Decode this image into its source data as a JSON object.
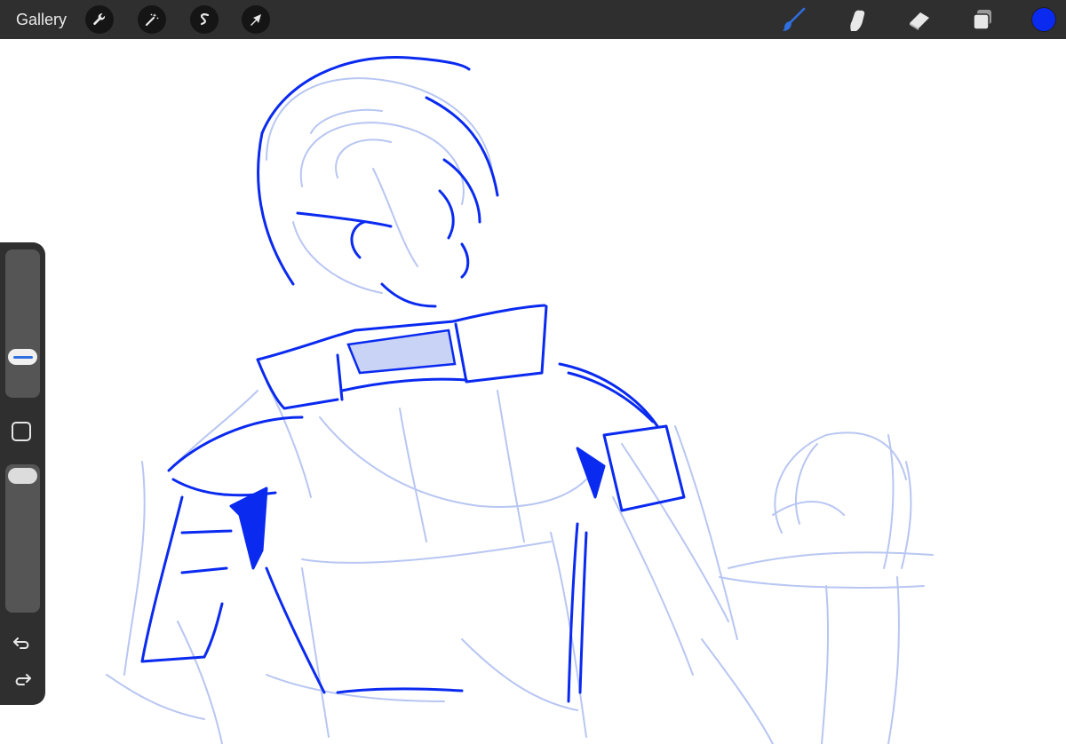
{
  "topbar": {
    "gallery_label": "Gallery",
    "left_tools": [
      {
        "name": "actions",
        "icon": "wrench-icon"
      },
      {
        "name": "adjustments",
        "icon": "magic-wand-icon"
      },
      {
        "name": "selection",
        "icon": "selection-s-icon"
      },
      {
        "name": "transform",
        "icon": "arrow-cursor-icon"
      }
    ],
    "right_tools": [
      {
        "name": "brush",
        "icon": "brush-icon",
        "active": true
      },
      {
        "name": "smudge",
        "icon": "smudge-icon"
      },
      {
        "name": "eraser",
        "icon": "eraser-icon"
      },
      {
        "name": "layers",
        "icon": "layers-icon"
      }
    ],
    "current_color": "#0a2af0",
    "active_tool_color": "#2f6fe0"
  },
  "sidebar": {
    "brush_size_level": 0.68,
    "opacity_level": 1.0,
    "modify_button": "square-icon",
    "undo": "undo-icon",
    "redo": "redo-icon"
  },
  "canvas": {
    "subject": "sketch",
    "ink_color": "#0a2af0",
    "sketch_color": "#b8c6f2",
    "fill_color": "#c9d3f5"
  }
}
